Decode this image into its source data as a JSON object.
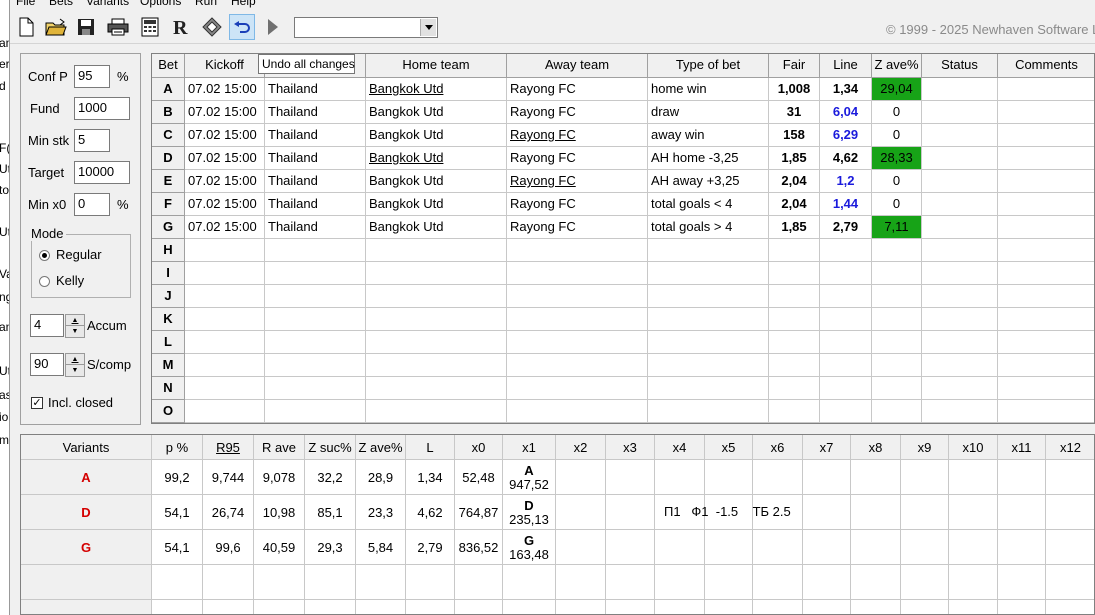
{
  "menu": [
    "File",
    "Bets",
    "Variants",
    "Options",
    "Run",
    "Help"
  ],
  "background_strip": [
    "am",
    "er",
    "d",
    "F(",
    "Ut",
    "to",
    "Ut",
    "Va",
    "ng",
    "an",
    "Ut",
    "as",
    "io",
    "m"
  ],
  "copyright": "© 1999 - 2025 Newhaven Software L",
  "tooltip": "Undo all changes",
  "params": {
    "conf_p_label": "Conf P",
    "conf_p_value": "95",
    "conf_p_unit": "%",
    "fund_label": "Fund",
    "fund_value": "1000",
    "min_stk_label": "Min stk",
    "min_stk_value": "5",
    "target_label": "Target",
    "target_value": "10000",
    "min_x0_label": "Min x0",
    "min_x0_value": "0",
    "min_x0_unit": "%",
    "mode_label": "Mode",
    "mode_regular": "Regular",
    "mode_kelly": "Kelly",
    "mode_selected": "Regular",
    "accum_value": "4",
    "accum_label": "Accum",
    "scomp_value": "90",
    "scomp_label": "S/comp",
    "incl_closed_label": "Incl. closed",
    "incl_closed_checked": true
  },
  "bets_table": {
    "headers": [
      "Bet",
      "Kickoff",
      "",
      "Home team",
      "Away team",
      "Type of bet",
      "Fair",
      "Line",
      "Z ave%",
      "Status",
      "Comments"
    ],
    "rows": [
      {
        "bet": "A",
        "kickoff": "07.02 15:00",
        "league": "Thailand",
        "home": "Bangkok Utd",
        "away": "Rayong FC",
        "type": "home win",
        "fair": "1,008",
        "line": "1,34",
        "zave": "29,04",
        "status": "",
        "comments": ""
      },
      {
        "bet": "B",
        "kickoff": "07.02 15:00",
        "league": "Thailand",
        "home": "Bangkok Utd",
        "away": "Rayong FC",
        "type": "draw",
        "fair": "31",
        "line": "6,04",
        "zave": "0",
        "status": "",
        "comments": ""
      },
      {
        "bet": "C",
        "kickoff": "07.02 15:00",
        "league": "Thailand",
        "home": "Bangkok Utd",
        "away": "Rayong FC",
        "type": "away win",
        "fair": "158",
        "line": "6,29",
        "zave": "0",
        "status": "",
        "comments": ""
      },
      {
        "bet": "D",
        "kickoff": "07.02 15:00",
        "league": "Thailand",
        "home": "Bangkok Utd",
        "away": "Rayong FC",
        "type": "AH home -3,25",
        "fair": "1,85",
        "line": "4,62",
        "zave": "28,33",
        "status": "",
        "comments": ""
      },
      {
        "bet": "E",
        "kickoff": "07.02 15:00",
        "league": "Thailand",
        "home": "Bangkok Utd",
        "away": "Rayong FC",
        "type": "AH away +3,25",
        "fair": "2,04",
        "line": "1,2",
        "zave": "0",
        "status": "",
        "comments": ""
      },
      {
        "bet": "F",
        "kickoff": "07.02 15:00",
        "league": "Thailand",
        "home": "Bangkok Utd",
        "away": "Rayong FC",
        "type": "total goals < 4",
        "fair": "2,04",
        "line": "1,44",
        "zave": "0",
        "status": "",
        "comments": ""
      },
      {
        "bet": "G",
        "kickoff": "07.02 15:00",
        "league": "Thailand",
        "home": "Bangkok Utd",
        "away": "Rayong FC",
        "type": "total goals > 4",
        "fair": "1,85",
        "line": "2,79",
        "zave": "7,11",
        "status": "",
        "comments": ""
      }
    ],
    "empty_bets": [
      "H",
      "I",
      "J",
      "K",
      "L",
      "M",
      "N",
      "O"
    ]
  },
  "variants_table": {
    "headers": [
      "Variants",
      "p %",
      "R95",
      "R ave",
      "Z suc%",
      "Z ave%",
      "L",
      "x0",
      "x1",
      "x2",
      "x3",
      "x4",
      "x5",
      "x6",
      "x7",
      "x8",
      "x9",
      "x10",
      "x11",
      "x12"
    ],
    "rows": [
      {
        "name": "A",
        "p": "99,2",
        "r95": "9,744",
        "rave": "9,078",
        "zsuc": "32,2",
        "zave": "28,9",
        "l": "1,34",
        "x0": "52,48",
        "x1_top": "A",
        "x1_bottom": "947,52",
        "note": ""
      },
      {
        "name": "D",
        "p": "54,1",
        "r95": "26,74",
        "rave": "10,98",
        "zsuc": "85,1",
        "zave": "23,3",
        "l": "4,62",
        "x0": "764,87",
        "x1_top": "D",
        "x1_bottom": "235,13",
        "note": "П1   Ф1  -1.5    ТБ 2.5"
      },
      {
        "name": "G",
        "p": "54,1",
        "r95": "99,6",
        "rave": "40,59",
        "zsuc": "29,3",
        "zave": "5,84",
        "l": "2,79",
        "x0": "836,52",
        "x1_top": "G",
        "x1_bottom": "163,48",
        "note": ""
      }
    ]
  },
  "colors": {
    "green_cell": "#17a317",
    "blue_line": "#1a1adc",
    "variant_red": "#d40000"
  }
}
